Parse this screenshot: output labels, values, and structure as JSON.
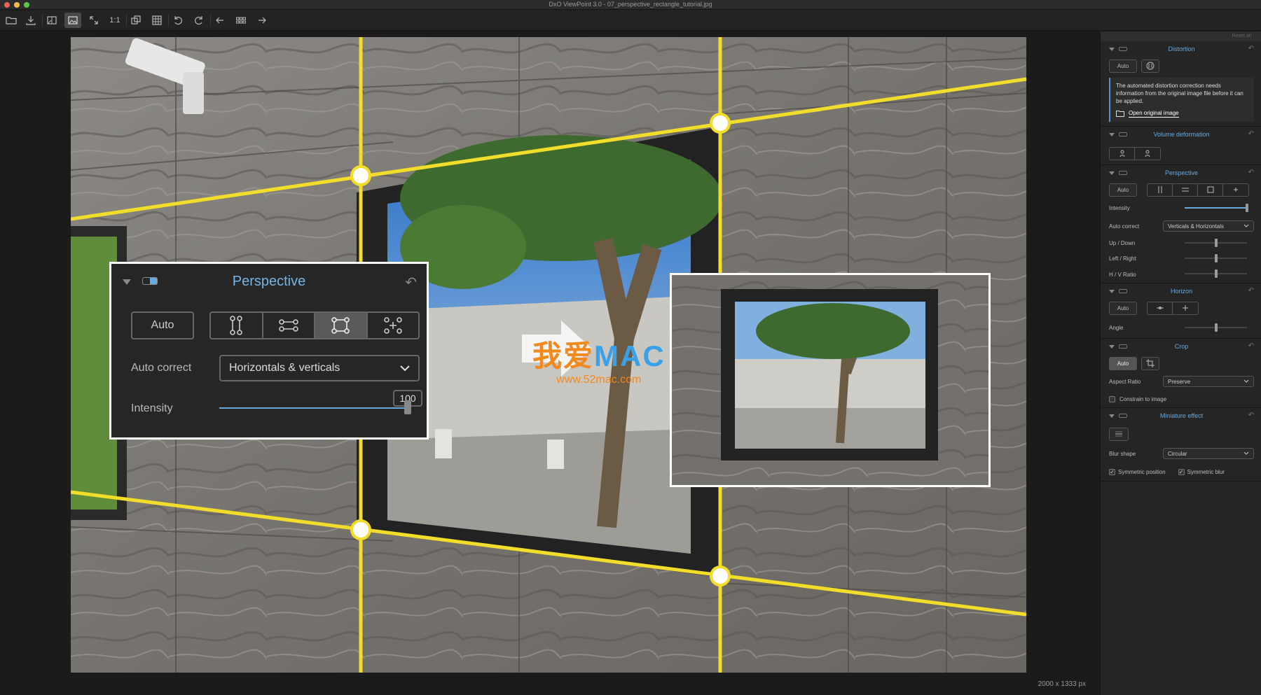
{
  "window": {
    "title": "DxO ViewPoint 3.0 - 07_perspective_rectangle_tutorial.jpg"
  },
  "toolbar": {
    "zoom_label": "1:1"
  },
  "image_info": {
    "size": "2000 x 1333 px"
  },
  "sidebar": {
    "reset_all": "Reset all",
    "distortion": {
      "title": "Distortion",
      "auto_label": "Auto",
      "info": "The automated distortion correction needs information from the original image file before it can be applied.",
      "open_link": "Open original image"
    },
    "volume": {
      "title": "Volume deformation"
    },
    "perspective": {
      "title": "Perspective",
      "auto_label": "Auto",
      "intensity_label": "Intensity",
      "intensity_value": 100,
      "auto_correct_label": "Auto correct",
      "auto_correct_value": "Verticals & Horizontals",
      "up_down_label": "Up / Down",
      "left_right_label": "Left / Right",
      "hv_ratio_label": "H / V Ratio"
    },
    "horizon": {
      "title": "Horizon",
      "auto_label": "Auto",
      "angle_label": "Angle"
    },
    "crop": {
      "title": "Crop",
      "auto_label": "Auto",
      "aspect_label": "Aspect Ratio",
      "aspect_value": "Preserve",
      "constrain_label": "Constrain to image"
    },
    "miniature": {
      "title": "Miniature effect",
      "blur_shape_label": "Blur shape",
      "blur_shape_value": "Circular",
      "sym_position_label": "Symmetric position",
      "sym_blur_label": "Symmetric blur"
    }
  },
  "overlay_panel": {
    "title": "Perspective",
    "auto_label": "Auto",
    "auto_correct_label": "Auto correct",
    "auto_correct_value": "Horizontals & verticals",
    "intensity_label": "Intensity",
    "intensity_value": "100"
  },
  "watermark": {
    "main_a": "我爱",
    "main_b": "MAC",
    "url": "www.52mac.com"
  },
  "colors": {
    "accent": "#6aa9de",
    "guide_line": "#f2dd2a"
  }
}
